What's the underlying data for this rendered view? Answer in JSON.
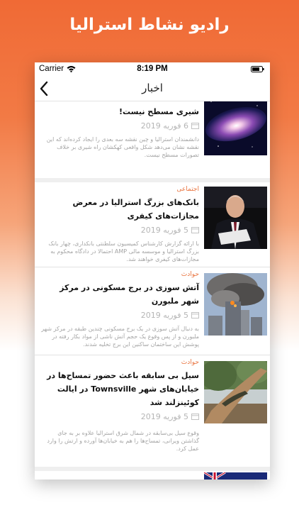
{
  "promo": {
    "title": "رادیو نشاط استرالیا"
  },
  "status_bar": {
    "carrier": "Carrier",
    "time": "8:19 PM"
  },
  "nav": {
    "title": "اخبار",
    "back_icon": "chevron-left-icon"
  },
  "colors": {
    "accent": "#e9733e",
    "promo_gradient_top": "#f06a35"
  },
  "articles": [
    {
      "category": "",
      "headline": "شیری مسطح نیست!",
      "date": "6 فوریه 2019",
      "summary": "دانشمندان استرالیا و چین نقشه سه بعدی را ایجاد کرده‌اند که این نقشه نشان می‌دهد شکل واقعی کهکشان راه شیری بر خلاف تصورات مسطح نیست."
    },
    {
      "category": "اجتماعی",
      "headline": "بانک‌های بزرگ استرالیا در معرض مجازات‌های کیفری",
      "date": "5 فوریه 2019",
      "summary": "با ارائه گزارش کارشناس کمیسیون سلطنتی بانکداری، چهار بانک بزرگ استرالیا و موسسه مالی AMP احتمالا در دادگاه محکوم به مجازات‌های کیفری خواهند شد."
    },
    {
      "category": "حوادث",
      "headline": "آتش سوزی در برج مسکونی در مرکز شهر ملبورن",
      "date": "5 فوریه 2019",
      "summary": "به دنبال آتش سوزی در یک برج مسکونی چندین طبقه در مرکز شهر ملبورن و از پس وقوع یک حجم آتش ناشی از مواد بکار رفته در پوشش این ساختمان ساکنین این برج تخلیه شدند."
    },
    {
      "category": "حوادث",
      "headline": "سیل بی سابقه باعث حضور  تمساح‌ها در خیابان‌های شهر Townsville در ایالت کوئینزلند شد",
      "date": "5 فوریه 2019",
      "summary": "وقوع سیل بی‌سابقه در شمال شرق استرالیا علاوه بر به جای گذاشتن ویرانی، تمساح‌ها را هم به خیابان‌ها آورده و ارتش را وارد عمل کرد."
    }
  ]
}
